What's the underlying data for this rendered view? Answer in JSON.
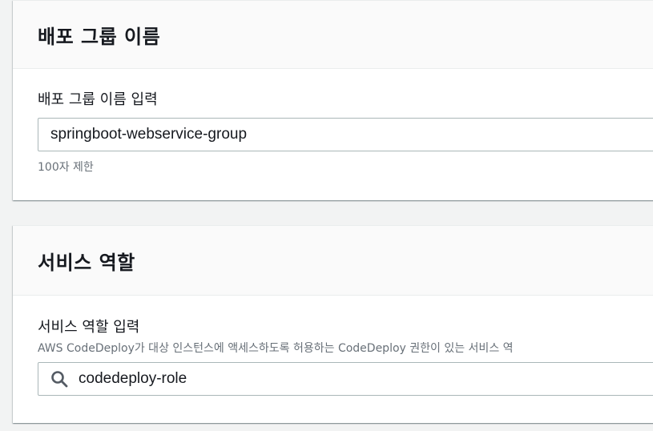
{
  "deployment_group": {
    "title": "배포 그룹 이름",
    "field_label": "배포 그룹 이름 입력",
    "value": "springboot-webservice-group",
    "constraint": "100자 제한"
  },
  "service_role": {
    "title": "서비스 역할",
    "field_label": "서비스 역할 입력",
    "description": "AWS CodeDeploy가 대상 인스턴스에 액세스하도록 허용하는 CodeDeploy 권한이 있는 서비스 역",
    "value": "codedeploy-role",
    "search_icon": "search-icon"
  }
}
